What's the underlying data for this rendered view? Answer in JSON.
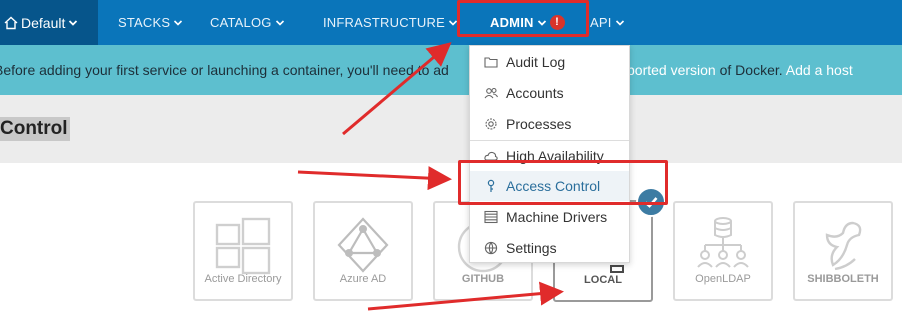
{
  "topnav": {
    "environment": "Default",
    "items": [
      {
        "label": "STACKS"
      },
      {
        "label": "CATALOG"
      },
      {
        "label": "INFRASTRUCTURE"
      },
      {
        "label": "ADMIN",
        "badge": "!"
      },
      {
        "label": "API"
      }
    ]
  },
  "banner": {
    "text_before": "Before adding your first service or launching a container, you'll need to ad",
    "link_version": "ported version",
    "text_after": " of Docker. ",
    "link_add_host": "Add a host"
  },
  "page": {
    "title": "Control"
  },
  "admin_menu": {
    "items": [
      {
        "label": "Audit Log",
        "icon": "folder-icon"
      },
      {
        "label": "Accounts",
        "icon": "users-icon"
      },
      {
        "label": "Processes",
        "icon": "gear-icon"
      },
      {
        "label": "High Availability",
        "icon": "cloud-icon"
      },
      {
        "label": "Access Control",
        "icon": "key-icon"
      },
      {
        "label": "Machine Drivers",
        "icon": "server-list-icon"
      },
      {
        "label": "Settings",
        "icon": "globe-icon"
      }
    ],
    "highlighted": "Access Control"
  },
  "auth_providers": [
    {
      "label": "Active Directory",
      "icon": "windows-icon"
    },
    {
      "label": "Azure AD",
      "icon": "azure-ad-icon"
    },
    {
      "label": "GITHUB",
      "icon": "github-icon"
    },
    {
      "label": "LOCAL",
      "icon": "local-icon",
      "selected": true
    },
    {
      "label": "OpenLDAP",
      "icon": "ldap-icon"
    },
    {
      "label": "SHIBBOLETH",
      "icon": "shibboleth-icon"
    }
  ],
  "colors": {
    "nav_bg": "#0a75ba",
    "env_bg": "#06558b",
    "banner_bg": "#5dbfcf",
    "annotation_red": "#e02b2b",
    "selected_badge": "#3d7ca3"
  }
}
